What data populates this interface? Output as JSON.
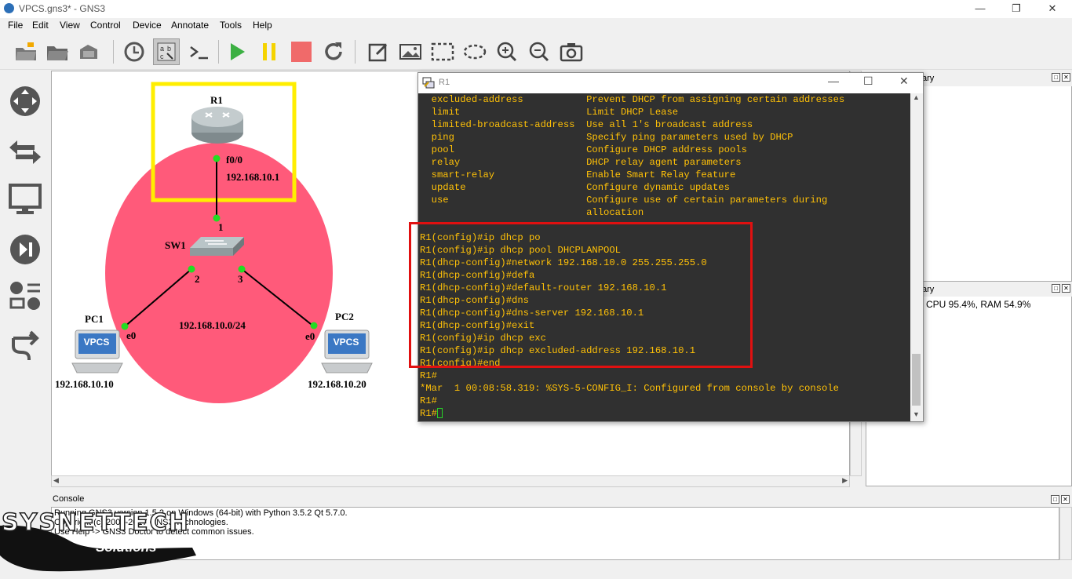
{
  "window": {
    "title": "VPCS.gns3* - GNS3"
  },
  "menu": [
    "File",
    "Edit",
    "View",
    "Control",
    "Device",
    "Annotate",
    "Tools",
    "Help"
  ],
  "toolbar": {
    "buttons": [
      "open-folder-icon",
      "open-file-icon",
      "snapshot-icon",
      "history-icon",
      "show-interface-labels-icon",
      "console-icon",
      "start-icon",
      "suspend-icon",
      "stop-icon",
      "reload-icon",
      "add-note-icon",
      "insert-picture-icon",
      "draw-rectangle-icon",
      "draw-ellipse-icon",
      "zoom-in-icon",
      "zoom-out-icon",
      "screenshot-icon"
    ]
  },
  "leftbar": [
    "routers-icon",
    "switches-icon",
    "end-devices-icon",
    "security-devices-icon",
    "all-devices-icon",
    "add-link-icon"
  ],
  "topology": {
    "r1": {
      "name": "R1",
      "port": "f0/0",
      "ip": "192.168.10.1"
    },
    "sw1": {
      "name": "SW1",
      "port1": "1",
      "port2": "2",
      "port3": "3"
    },
    "pc1": {
      "name": "PC1",
      "port": "e0",
      "ip": "192.168.10.10",
      "badge": "VPCS"
    },
    "pc2": {
      "name": "PC2",
      "port": "e0",
      "ip": "192.168.10.20",
      "badge": "VPCS"
    },
    "network": "192.168.10.0/24",
    "colors": {
      "highlight_box": "#ffee00",
      "network_ellipse": "#ff5a7a",
      "link_dot": "#22dd22"
    }
  },
  "terminal": {
    "title": "R1",
    "lines": [
      "  excluded-address           Prevent DHCP from assigning certain addresses",
      "  limit                      Limit DHCP Lease",
      "  limited-broadcast-address  Use all 1's broadcast address",
      "  ping                       Specify ping parameters used by DHCP",
      "  pool                       Configure DHCP address pools",
      "  relay                      DHCP relay agent parameters",
      "  smart-relay                Enable Smart Relay feature",
      "  update                     Configure dynamic updates",
      "  use                        Configure use of certain parameters during",
      "                             allocation",
      "",
      "R1(config)#ip dhcp po",
      "R1(config)#ip dhcp pool DHCPLANPOOL",
      "R1(dhcp-config)#network 192.168.10.0 255.255.255.0",
      "R1(dhcp-config)#defa",
      "R1(dhcp-config)#default-router 192.168.10.1",
      "R1(dhcp-config)#dns",
      "R1(dhcp-config)#dns-server 192.168.10.1",
      "R1(dhcp-config)#exit",
      "R1(config)#ip dhcp exc",
      "R1(config)#ip dhcp excluded-address 192.168.10.1",
      "R1(config)#end",
      "R1#",
      "*Mar  1 00:08:58.319: %SYS-5-CONFIG_I: Configured from console by console",
      "R1#",
      "R1#"
    ],
    "colors": {
      "background": "#303030",
      "text": "#ffc107",
      "highlight_box": "#e01010"
    }
  },
  "panels": {
    "top_title": "ary",
    "bottom_title": "ary",
    "status_text": "CPU 95.4%, RAM 54.9%"
  },
  "console": {
    "title": "Console",
    "lines": [
      "Running GNS3 version 1.5.2 on Windows (64-bit) with Python 3.5.2 Qt 5.7.0.",
      "Copyright (c) 2006-2017 GNS3 Technologies.",
      "Use Help -> GNS3 Doctor to detect common issues.",
      "",
      "=>"
    ]
  },
  "watermark": {
    "brand": "SYSNETTECH",
    "tagline": "Solutions"
  }
}
